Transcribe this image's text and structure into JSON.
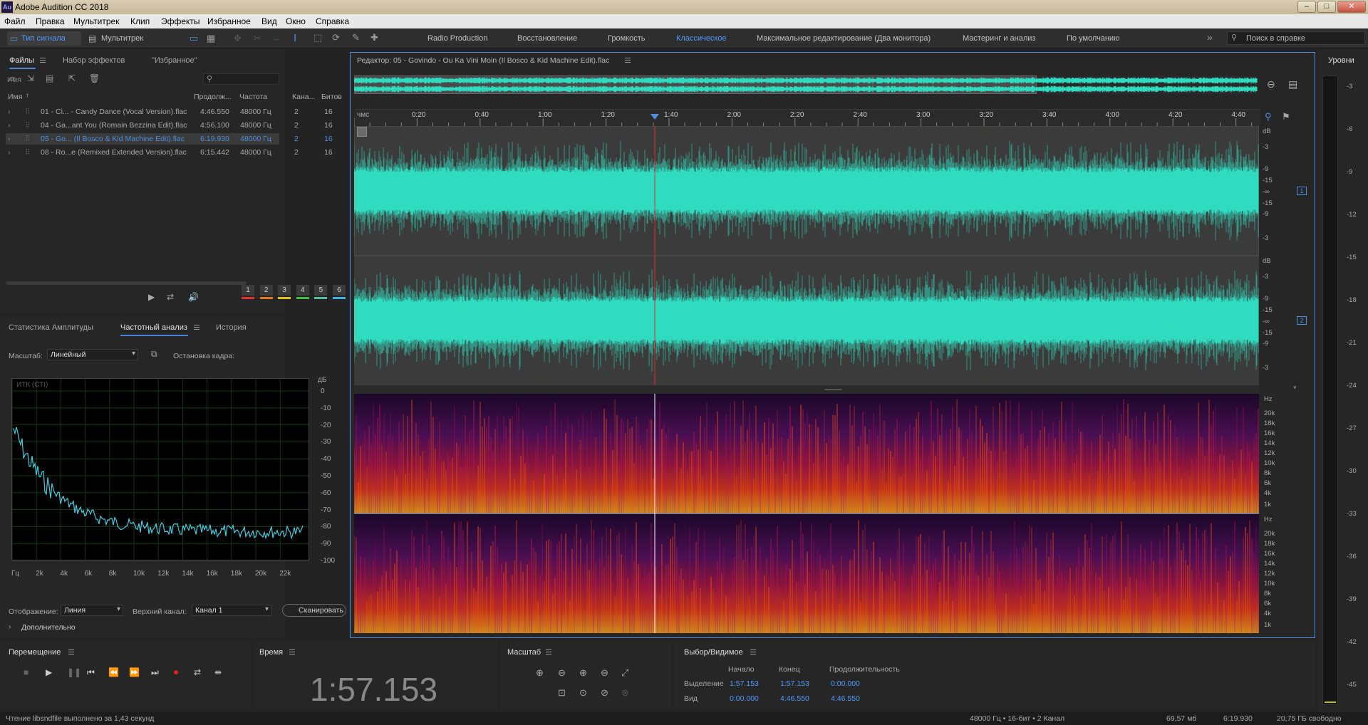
{
  "window": {
    "title": "Adobe Audition CC 2018",
    "app_icon": "Au"
  },
  "menu": [
    "Файл",
    "Правка",
    "Мультитрек",
    "Клип",
    "Эффекты",
    "Избранное",
    "Вид",
    "Окно",
    "Справка"
  ],
  "toolbar": {
    "waveform_view": "Тип сигнала",
    "multitrack_view": "Мультитрек",
    "workspaces": [
      "Radio Production",
      "Восстановление",
      "Громкость",
      "Классическое",
      "Максимальное редактирование (Два монитора)",
      "Мастеринг и анализ",
      "По умолчанию"
    ],
    "active_workspace": "Классическое",
    "help_search_placeholder": "Поиск в справке"
  },
  "files_panel": {
    "tabs": [
      "Файлы",
      "Набор эффектов",
      "\"Избранное\""
    ],
    "columns": [
      "Имя",
      "Продолж...",
      "Частота",
      "Кана...",
      "Битов"
    ],
    "rows": [
      {
        "name": "01 - Ci... - Candy Dance (Vocal Version).flac",
        "duration": "4:46.550",
        "rate": "48000 Гц",
        "channels": "2",
        "bits": "16",
        "selected": false
      },
      {
        "name": "04 - Ga...ant You (Romain Bezzina Edit).flac",
        "duration": "4:56.100",
        "rate": "48000 Гц",
        "channels": "2",
        "bits": "16",
        "selected": false
      },
      {
        "name": "05 - Go... (Il Bosco & Kid Machine Edit).flac",
        "duration": "6:19.930",
        "rate": "48000 Гц",
        "channels": "2",
        "bits": "16",
        "selected": true
      },
      {
        "name": "08 - Ro...e (Remixed Extended Version).flac",
        "duration": "6:15.442",
        "rate": "48000 Гц",
        "channels": "2",
        "bits": "16",
        "selected": false
      }
    ]
  },
  "analysis_panel": {
    "tabs": [
      "Статистика Амплитуды",
      "Частотный анализ",
      "История"
    ],
    "active_tab": "Частотный анализ",
    "scale_label": "Масштаб:",
    "scale_value": "Линейный",
    "hold_label": "Остановка кадра:",
    "hold_buttons": [
      "1",
      "2",
      "3",
      "4",
      "5",
      "6"
    ],
    "hold_colors": [
      "#e03030",
      "#e07a20",
      "#e0c020",
      "#40c040",
      "#50c0a0",
      "#40b0e0"
    ],
    "graph_label": "ИТК (СТI)",
    "db_unit": "дБ",
    "db_ticks": [
      "0",
      "-10",
      "-20",
      "-30",
      "-40",
      "-50",
      "-60",
      "-70",
      "-80",
      "-90",
      "-100"
    ],
    "freq_ticks": [
      "Гц",
      "2k",
      "4k",
      "6k",
      "8k",
      "10k",
      "12k",
      "14k",
      "16k",
      "18k",
      "20k",
      "22k"
    ],
    "display_label": "Отображение:",
    "display_value": "Линия",
    "top_channel_label": "Верхний канал:",
    "top_channel_value": "Канал 1",
    "scan_button": "Сканировать",
    "advanced": "Дополнительно"
  },
  "editor": {
    "title": "Редактор: 05 - Govindo - Ou Ka Vini Moin (Il Bosco & Kid Machine Edit).flac",
    "time_unit": "чмс",
    "time_ticks": [
      "0:20",
      "0:40",
      "1:00",
      "1:20",
      "1:40",
      "2:00",
      "2:20",
      "2:40",
      "3:00",
      "3:20",
      "3:40",
      "4:00",
      "4:20",
      "4:40"
    ],
    "db_ticks_ch": [
      "dB",
      "-3",
      "-9",
      "-15",
      "-∞",
      "-15",
      "-9",
      "-3"
    ],
    "channels": [
      "1",
      "2"
    ],
    "hz_ticks": [
      "Hz",
      "20k",
      "18k",
      "16k",
      "14k",
      "12k",
      "10k",
      "8k",
      "6k",
      "4k",
      "1k"
    ],
    "waveform_color": "#2fdcc0",
    "playhead_time": "1:57.153"
  },
  "levels": {
    "title": "Уровни",
    "ticks": [
      "-3",
      "-6",
      "-9",
      "-12",
      "-15",
      "-18",
      "-21",
      "-24",
      "-27",
      "-30",
      "-33",
      "-36",
      "-39",
      "-42",
      "-45"
    ]
  },
  "transport": {
    "title": "Перемещение"
  },
  "time_panel": {
    "title": "Время",
    "value": "1:57.153"
  },
  "zoom_panel": {
    "title": "Масштаб"
  },
  "selection_panel": {
    "title": "Выбор/Видимое",
    "col_start": "Начало",
    "col_end": "Конец",
    "col_duration": "Продолжительность",
    "row_selection": "Выделение",
    "row_view": "Вид",
    "sel_start": "1:57.153",
    "sel_end": "1:57.153",
    "sel_duration": "0:00.000",
    "view_start": "0:00.000",
    "view_end": "4:46.550",
    "view_duration": "4:46.550"
  },
  "status": {
    "message": "Чтение libsndfile выполнено за 1,43 секунд",
    "format": "48000 Гц • 16-бит • 2 Канал",
    "size": "69,57 мб",
    "duration": "6:19.930",
    "free": "20,75 ГБ свободно"
  }
}
